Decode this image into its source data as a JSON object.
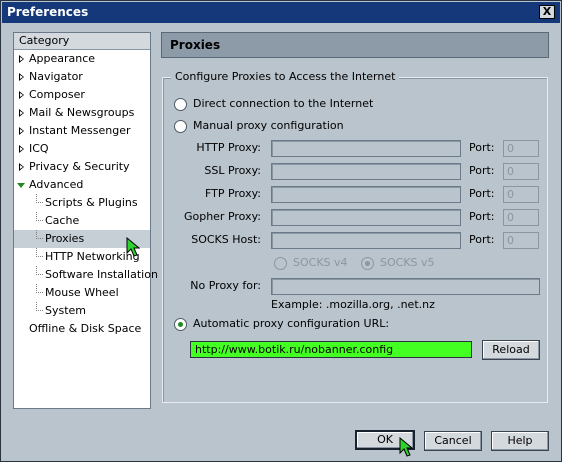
{
  "window": {
    "title": "Preferences",
    "close_glyph": "X"
  },
  "sidebar": {
    "header": "Category",
    "items": [
      {
        "label": "Appearance",
        "level": 0,
        "twisty": "closed"
      },
      {
        "label": "Navigator",
        "level": 0,
        "twisty": "closed"
      },
      {
        "label": "Composer",
        "level": 0,
        "twisty": "closed"
      },
      {
        "label": "Mail & Newsgroups",
        "level": 0,
        "twisty": "closed"
      },
      {
        "label": "Instant Messenger",
        "level": 0,
        "twisty": "closed"
      },
      {
        "label": "ICQ",
        "level": 0,
        "twisty": "closed"
      },
      {
        "label": "Privacy & Security",
        "level": 0,
        "twisty": "closed"
      },
      {
        "label": "Advanced",
        "level": 0,
        "twisty": "open"
      },
      {
        "label": "Scripts & Plugins",
        "level": 1
      },
      {
        "label": "Cache",
        "level": 1
      },
      {
        "label": "Proxies",
        "level": 1,
        "selected": true
      },
      {
        "label": "HTTP Networking",
        "level": 1
      },
      {
        "label": "Software Installation",
        "level": 1
      },
      {
        "label": "Mouse Wheel",
        "level": 1
      },
      {
        "label": "System",
        "level": 1
      },
      {
        "label": "Offline & Disk Space",
        "level": 0
      }
    ]
  },
  "panel": {
    "title": "Proxies",
    "group_label": "Configure Proxies to Access the Internet",
    "radio_direct": "Direct connection to the Internet",
    "radio_manual": "Manual proxy configuration",
    "proxies": [
      {
        "label": "HTTP Proxy:",
        "port_label": "Port:",
        "port_value": "0"
      },
      {
        "label": "SSL Proxy:",
        "port_label": "Port:",
        "port_value": "0"
      },
      {
        "label": "FTP Proxy:",
        "port_label": "Port:",
        "port_value": "0"
      },
      {
        "label": "Gopher Proxy:",
        "port_label": "Port:",
        "port_value": "0"
      },
      {
        "label": "SOCKS Host:",
        "port_label": "Port:",
        "port_value": "0"
      }
    ],
    "socks_v4": "SOCKS v4",
    "socks_v5": "SOCKS v5",
    "no_proxy_label": "No Proxy for:",
    "no_proxy_example": "Example: .mozilla.org, .net.nz",
    "radio_auto": "Automatic proxy configuration URL:",
    "auto_url": "http://www.botik.ru/nobanner.config",
    "reload_label": "Reload",
    "selected_mode": "auto"
  },
  "buttons": {
    "ok": "OK",
    "cancel": "Cancel",
    "help": "Help"
  },
  "colors": {
    "url_highlight": "#44ff22",
    "title_bar": "#14387a",
    "cursor": "#2fd12f"
  }
}
